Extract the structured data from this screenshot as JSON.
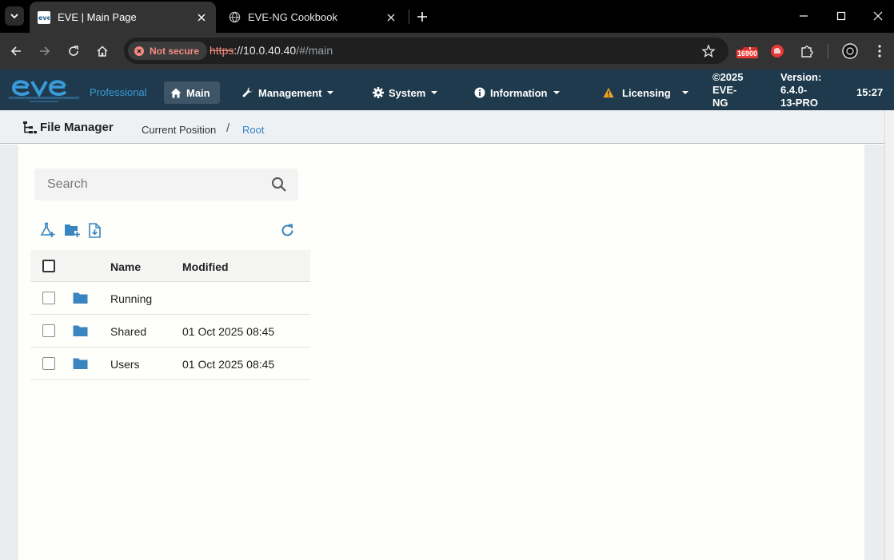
{
  "browser": {
    "tabs": [
      {
        "title": "EVE | Main Page",
        "active": true,
        "favicon": "eve-favicon-icon"
      },
      {
        "title": "EVE-NG Cookbook",
        "active": false,
        "favicon": "globe-icon"
      }
    ],
    "security_label": "Not secure",
    "url_scheme": "https",
    "url_host": "://10.0.40.40",
    "url_path": "/#/main",
    "extension_badge": "16900"
  },
  "navbar": {
    "edition": "Professional",
    "items": [
      {
        "label": "Main",
        "icon": "home-icon",
        "active": true
      },
      {
        "label": "Management",
        "icon": "wrench-icon"
      },
      {
        "label": "System",
        "icon": "gear-icon"
      },
      {
        "label": "Information",
        "icon": "info-icon"
      },
      {
        "label": "Licensing",
        "icon": "warning-icon"
      }
    ],
    "copyright": [
      "©2025",
      "EVE-",
      "NG"
    ],
    "version": [
      "Version:",
      "6.4.0-",
      "13-PRO"
    ],
    "clock": "15:27",
    "colors": {
      "bar": "#1f3a4c",
      "accent": "#3a9ad9",
      "warning": "#f0a020"
    }
  },
  "breadcrumb": {
    "title": "File Manager",
    "label": "Current Position",
    "separator": "/",
    "current": "Root"
  },
  "file_manager": {
    "search_placeholder": "Search",
    "columns": {
      "name": "Name",
      "modified": "Modified"
    },
    "rows": [
      {
        "name": "Running",
        "modified": ""
      },
      {
        "name": "Shared",
        "modified": "01 Oct 2025 08:45"
      },
      {
        "name": "Users",
        "modified": "01 Oct 2025 08:45"
      }
    ],
    "colors": {
      "folder": "#3a85c0"
    }
  }
}
